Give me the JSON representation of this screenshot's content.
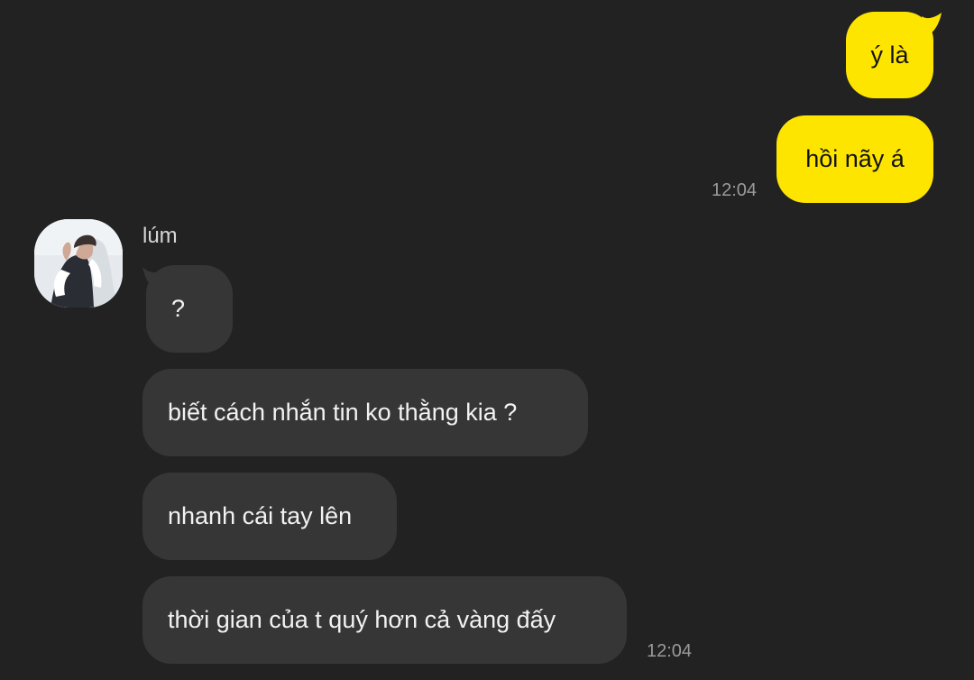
{
  "colors": {
    "background": "#222222",
    "outgoing_bubble": "#fee500",
    "incoming_bubble": "#363636",
    "timestamp": "#9a9a9a"
  },
  "outgoing": {
    "messages": [
      "ý là",
      "hồi nãy á"
    ],
    "time": "12:04"
  },
  "incoming": {
    "sender": "lúm",
    "avatar_icon": "profile-photo",
    "messages": [
      "?",
      "biết cách nhắn tin ko thằng kia ?",
      "nhanh cái tay lên",
      "thời gian của t quý hơn cả vàng đấy"
    ],
    "time": "12:04"
  }
}
